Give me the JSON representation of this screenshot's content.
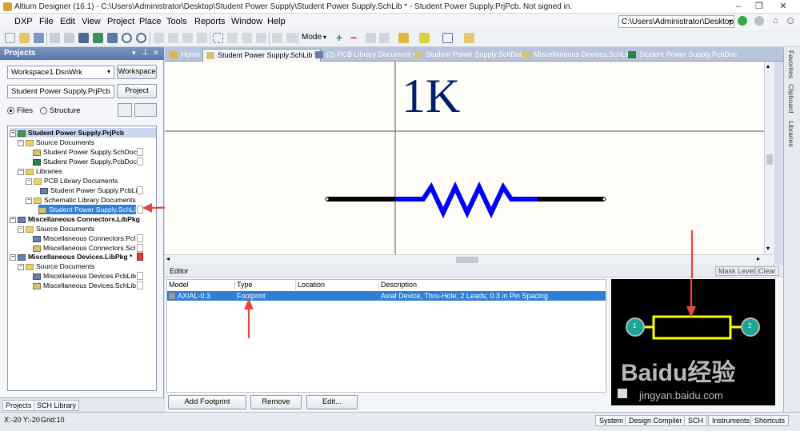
{
  "app": {
    "title": "Altium Designer (16.1) - C:\\Users\\Administrator\\Desktop\\Student Power Supply\\Student Power Supply.SchLib * - Student Power Supply.PrjPcb. Not signed in."
  },
  "menubar": {
    "items": [
      "DXP",
      "File",
      "Edit",
      "View",
      "Project",
      "Place",
      "Tools",
      "Reports",
      "Window",
      "Help"
    ],
    "path": "C:\\Users\\Administrator\\Desktop\\"
  },
  "toolbar": {
    "mode_label": "Mode"
  },
  "projects_panel": {
    "title": "Projects",
    "workspace_field": "Workspace1.DsnWrk",
    "workspace_button": "Workspace",
    "project_field": "Student Power Supply.PrjPcb",
    "project_button": "Project",
    "view_files": "Files",
    "view_structure": "Structure",
    "tree": [
      {
        "label": "Student Power Supply.PrjPcb"
      },
      {
        "label": "Source Documents"
      },
      {
        "label": "Student Power Supply.SchDoc"
      },
      {
        "label": "Student Power Supply.PcbDoc"
      },
      {
        "label": "Libraries"
      },
      {
        "label": "PCB Library Documents"
      },
      {
        "label": "Student Power Supply.PcbLib"
      },
      {
        "label": "Schematic Library Documents"
      },
      {
        "label": "Student Power Supply.SchLib"
      },
      {
        "label": "Miscellaneous Connectors.LibPkg"
      },
      {
        "label": "Source Documents"
      },
      {
        "label": "Miscellaneous Connectors.PcbLib"
      },
      {
        "label": "Miscellaneous Connectors.SchLib"
      },
      {
        "label": "Miscellaneous Devices.LibPkg *"
      },
      {
        "label": "Source Documents"
      },
      {
        "label": "Miscellaneous Devices.PcbLib"
      },
      {
        "label": "Miscellaneous Devices.SchLib"
      }
    ],
    "bottom_tabs": [
      "Projects",
      "SCH Library"
    ]
  },
  "doc_tabs": [
    {
      "label": "Home"
    },
    {
      "label": "Student Power Supply.SchLib *"
    },
    {
      "label": "(2) PCB Library Document"
    },
    {
      "label": "Student Power Supply.SchDoc"
    },
    {
      "label": "Miscellaneous Devices.SchLib"
    },
    {
      "label": "Student Power Supply.PcbDoc"
    }
  ],
  "schematic": {
    "component_value": "1K"
  },
  "right_tabs": [
    "Favorites",
    "Clipboard",
    "Libraries"
  ],
  "editor": {
    "title": "Editor",
    "mask_level": "Mask Level",
    "clear": "Clear",
    "columns": [
      "Model",
      "Type",
      "Location",
      "Description"
    ],
    "rows": [
      {
        "model": "AXIAL-0.3",
        "type": "Footprint",
        "location": "",
        "description": "Axial Device, Thru-Hole; 2 Leads; 0.3 in Pin Spacing"
      }
    ],
    "buttons": {
      "add_footprint": "Add Footprint",
      "remove": "Remove",
      "edit": "Edit..."
    },
    "preview_pads": [
      "1",
      "2"
    ]
  },
  "watermark": {
    "brand": "Baidu经验",
    "url": "jingyan.baidu.com"
  },
  "statusbar": {
    "coords": "X:-20 Y:-20",
    "grid": "Grid:10",
    "buttons": [
      "System",
      "Design Compiler",
      "SCH",
      "Instruments",
      "Shortcuts"
    ]
  },
  "colors": {
    "accent": "#2f7fd6",
    "resistor": "#0000ff",
    "value_text": "#00206f",
    "outline": "#ffff00",
    "pad": "#1aa59a"
  }
}
